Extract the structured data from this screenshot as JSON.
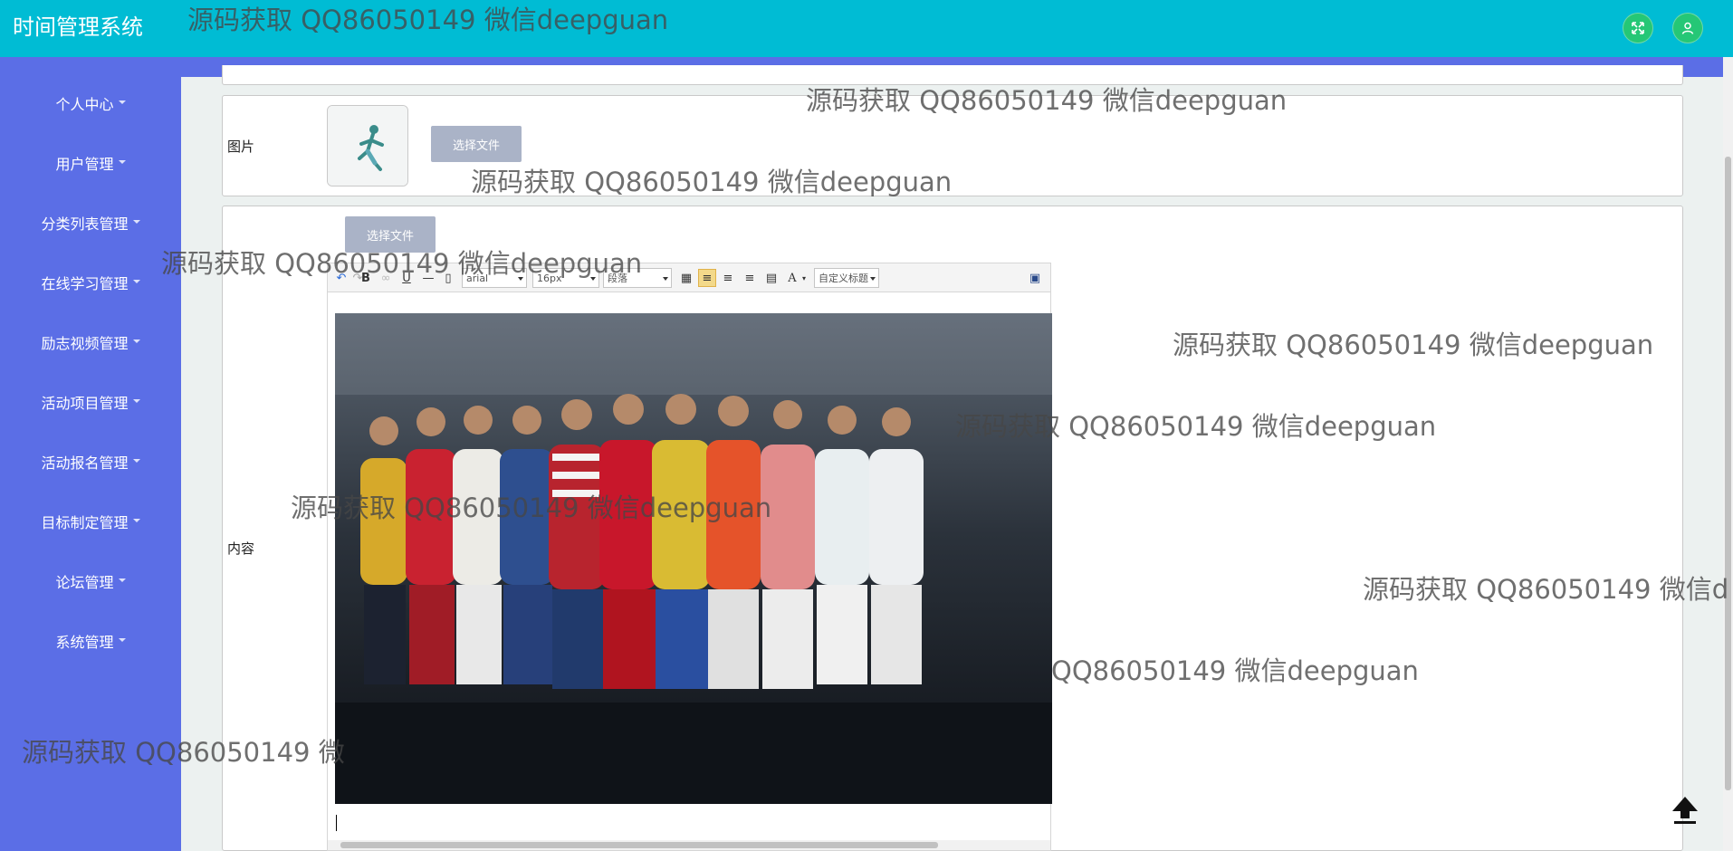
{
  "header": {
    "title": "时间管理系统"
  },
  "sidebar": {
    "items": [
      {
        "label": "个人中心"
      },
      {
        "label": "用户管理"
      },
      {
        "label": "分类列表管理"
      },
      {
        "label": "在线学习管理"
      },
      {
        "label": "励志视频管理"
      },
      {
        "label": "活动项目管理"
      },
      {
        "label": "活动报名管理"
      },
      {
        "label": "目标制定管理"
      },
      {
        "label": "论坛管理"
      },
      {
        "label": "系统管理"
      }
    ]
  },
  "form": {
    "image_label": "图片",
    "content_label": "内容",
    "choose_file": "选择文件",
    "choose_file_2": "选择文件"
  },
  "editor": {
    "font_family": "arial",
    "font_size": "16px",
    "paragraph": "段落",
    "custom_title": "自定义标题",
    "bold": "B",
    "underline": "U",
    "font_color": "A"
  },
  "watermark": {
    "text": "源码获取 QQ86050149 微信deepguan",
    "text_cut_1": "源码获取 QQ86050149 微信d",
    "text_cut_2": "源码获取 QQ86050149 微",
    "text_cut_3": "QQ86050149 微信deepguan"
  },
  "colors": {
    "header": "#00bcd4",
    "sidebar": "#5b6ee6",
    "header_button": "#25c776",
    "file_button": "#aab3c7"
  }
}
